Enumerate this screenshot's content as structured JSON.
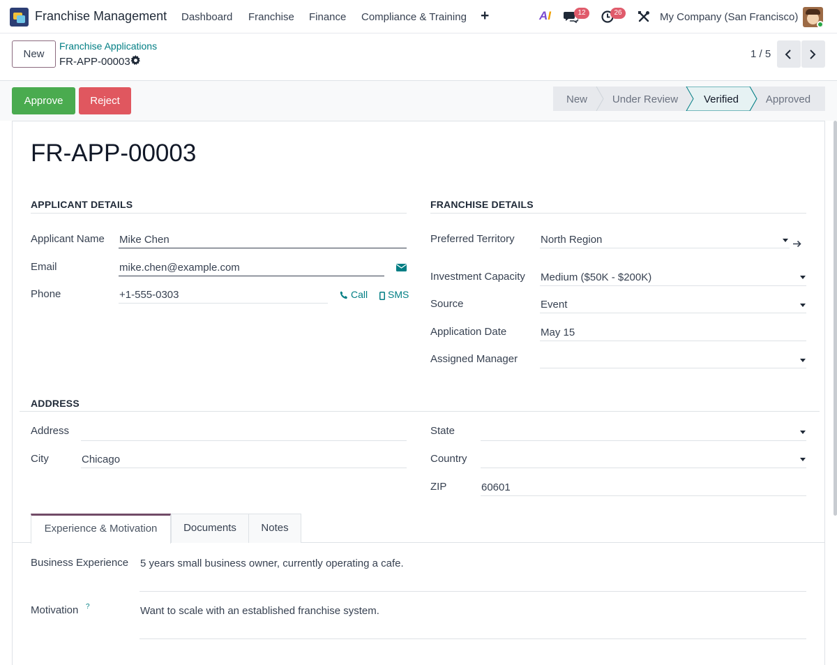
{
  "topbar": {
    "app_name": "Franchise Management",
    "menu": [
      "Dashboard",
      "Franchise",
      "Finance",
      "Compliance & Training"
    ],
    "add_icon": "plus-icon",
    "ai_label": "AI",
    "messages_count": "12",
    "activities_count": "26",
    "company": "My Company (San Francisco)"
  },
  "control": {
    "new_label": "New",
    "breadcrumb_parent": "Franchise Applications",
    "breadcrumb_current": "FR-APP-00003",
    "pager": "1 / 5"
  },
  "actions": {
    "approve": "Approve",
    "reject": "Reject"
  },
  "status": {
    "stages": [
      "New",
      "Under Review",
      "Verified",
      "Approved"
    ],
    "current": "Verified"
  },
  "record": {
    "title": "FR-APP-00003"
  },
  "applicant": {
    "section": "APPLICANT DETAILS",
    "name_label": "Applicant Name",
    "name": "Mike Chen",
    "email_label": "Email",
    "email": "mike.chen@example.com",
    "phone_label": "Phone",
    "phone": "+1-555-0303",
    "call_label": "Call",
    "sms_label": "SMS"
  },
  "franchise": {
    "section": "FRANCHISE DETAILS",
    "territory_label": "Preferred Territory",
    "territory": "North Region",
    "investment_label": "Investment Capacity",
    "investment": "Medium ($50K - $200K)",
    "source_label": "Source",
    "source": "Event",
    "date_label": "Application Date",
    "date": "May 15",
    "manager_label": "Assigned Manager",
    "manager": ""
  },
  "address": {
    "section": "ADDRESS",
    "address_label": "Address",
    "address": "",
    "city_label": "City",
    "city": "Chicago",
    "state_label": "State",
    "state": "",
    "country_label": "Country",
    "country": "",
    "zip_label": "ZIP",
    "zip": "60601"
  },
  "tabs": [
    "Experience & Motivation",
    "Documents",
    "Notes"
  ],
  "experience": {
    "business_label": "Business Experience",
    "business": "5 years small business owner, currently operating a cafe.",
    "motivation_label": "Motivation",
    "motivation_help": "?",
    "motivation": "Want to scale with an established franchise system."
  },
  "colors": {
    "accent": "#714b67",
    "link": "#017e84",
    "approve": "#4aab4f",
    "reject": "#e0575f",
    "badge": "#e05b6b"
  }
}
